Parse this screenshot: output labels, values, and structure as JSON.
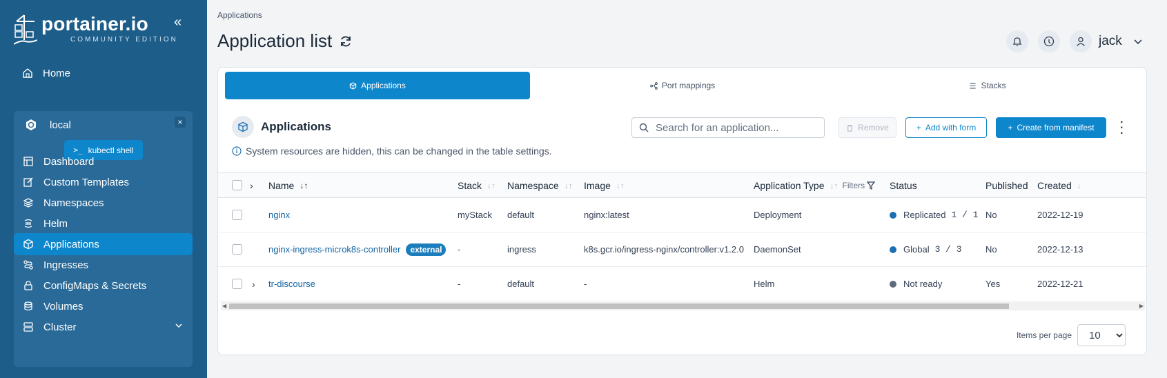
{
  "brand": {
    "name": "portainer.io",
    "edition": "COMMUNITY EDITION"
  },
  "sidebar": {
    "home_label": "Home",
    "environment": {
      "name": "local",
      "kubectl_label": "kubectl shell",
      "close_glyph": "×"
    },
    "items": [
      {
        "label": "Dashboard",
        "icon": "dashboard-icon"
      },
      {
        "label": "Custom Templates",
        "icon": "edit-icon"
      },
      {
        "label": "Namespaces",
        "icon": "layers-icon"
      },
      {
        "label": "Helm",
        "icon": "helm-icon"
      },
      {
        "label": "Applications",
        "icon": "box-icon",
        "active": true
      },
      {
        "label": "Ingresses",
        "icon": "route-icon"
      },
      {
        "label": "ConfigMaps & Secrets",
        "icon": "lock-icon"
      },
      {
        "label": "Volumes",
        "icon": "database-icon"
      },
      {
        "label": "Cluster",
        "icon": "server-icon"
      }
    ]
  },
  "header": {
    "breadcrumb": "Applications",
    "title": "Application list",
    "user": "jack"
  },
  "tabs": [
    {
      "label": "Applications",
      "icon": "box-icon",
      "active": true
    },
    {
      "label": "Port mappings",
      "icon": "network-icon"
    },
    {
      "label": "Stacks",
      "icon": "list-icon"
    }
  ],
  "section": {
    "title": "Applications",
    "search_placeholder": "Search for an application...",
    "remove_label": "Remove",
    "add_form_label": "Add with form",
    "create_manifest_label": "Create from manifest",
    "info": "System resources are hidden, this can be changed in the table settings."
  },
  "table": {
    "columns": {
      "name": "Name",
      "stack": "Stack",
      "namespace": "Namespace",
      "image": "Image",
      "app_type": "Application Type",
      "filters": "Filters",
      "status": "Status",
      "published": "Published",
      "created": "Created"
    },
    "rows": [
      {
        "name": "nginx",
        "badge": "",
        "stack": "myStack",
        "namespace": "default",
        "image": "nginx:latest",
        "app_type": "Deployment",
        "status": "Replicated",
        "replicas": "1 / 1",
        "status_color": "#1c6fb3",
        "published": "No",
        "created": "2022-12-19"
      },
      {
        "name": "nginx-ingress-microk8s-controller",
        "badge": "external",
        "stack": "-",
        "namespace": "ingress",
        "image": "k8s.gcr.io/ingress-nginx/controller:v1.2.0",
        "app_type": "DaemonSet",
        "status": "Global",
        "replicas": "3 / 3",
        "status_color": "#1c6fb3",
        "published": "No",
        "created": "2022-12-13"
      },
      {
        "name": "tr-discourse",
        "badge": "",
        "stack": "-",
        "namespace": "default",
        "image": "-",
        "app_type": "Helm",
        "status": "Not ready",
        "replicas": "",
        "status_color": "#5d6b7a",
        "published": "Yes",
        "created": "2022-12-21"
      }
    ]
  },
  "pagination": {
    "label": "Items per page",
    "value": "10"
  },
  "colors": {
    "sidebar": "#1d5d8a",
    "accent": "#0e86cc"
  }
}
